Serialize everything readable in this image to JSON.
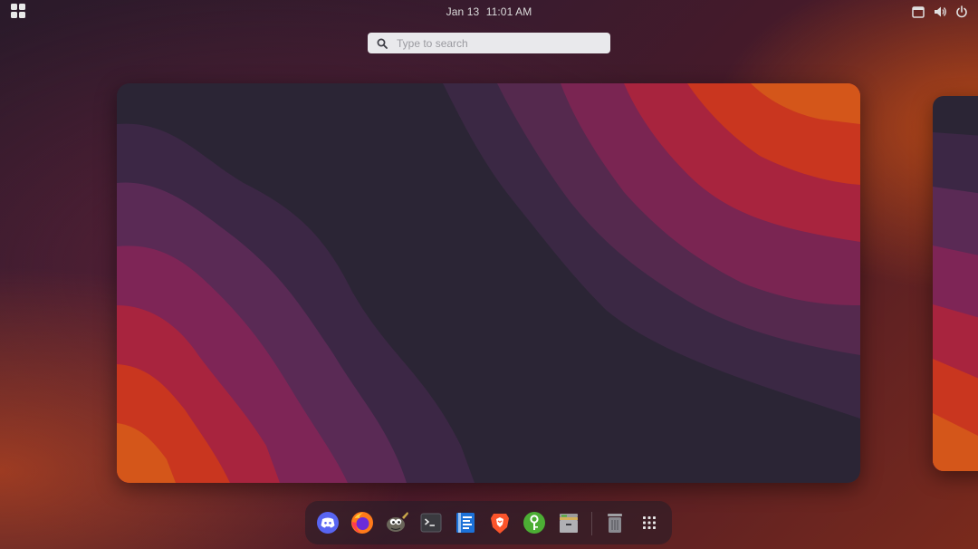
{
  "topbar": {
    "activities_icon": "activities-grid-icon",
    "date": "Jan 13",
    "time": "11:01 AM",
    "status_icons": [
      "screen-icon",
      "volume-icon",
      "power-icon"
    ]
  },
  "search": {
    "placeholder": "Type to search",
    "icon": "search-icon"
  },
  "wallpaper": {
    "colors": [
      "#2e2438",
      "#3d2844",
      "#55294e",
      "#7a2552",
      "#a8243e",
      "#c9361f",
      "#d4561a"
    ]
  },
  "dock": {
    "apps": [
      {
        "name": "discord",
        "icon": "discord-icon"
      },
      {
        "name": "firefox",
        "icon": "firefox-icon"
      },
      {
        "name": "gimp",
        "icon": "gimp-icon"
      },
      {
        "name": "terminal",
        "icon": "terminal-icon"
      },
      {
        "name": "text-editor",
        "icon": "text-editor-icon"
      },
      {
        "name": "brave",
        "icon": "brave-icon"
      },
      {
        "name": "keepassxc",
        "icon": "keepass-icon"
      },
      {
        "name": "archive-manager",
        "icon": "archive-icon"
      }
    ],
    "trash": {
      "icon": "trash-icon"
    },
    "app_grid": {
      "icon": "show-apps-icon"
    }
  }
}
